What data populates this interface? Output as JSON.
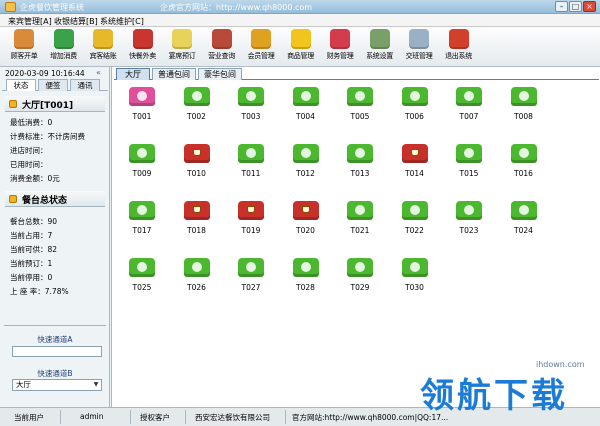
{
  "window": {
    "title": "企虎餐饮管理系统",
    "site": "企虎官方网站：http://www.qh8000.com",
    "buttons": [
      "–",
      "□",
      "×"
    ]
  },
  "menu": [
    {
      "label": "来宾管理[A]"
    },
    {
      "label": "收银结算[B]"
    },
    {
      "label": "系统维护[C]"
    }
  ],
  "toolbar": [
    {
      "label": "顾客开单",
      "icon": "customer-icon",
      "color": "#d98b3a"
    },
    {
      "label": "增加消费",
      "icon": "add-consume-icon",
      "color": "#3ca24a"
    },
    {
      "label": "宾客结账",
      "icon": "checkout-icon",
      "color": "#e6b82a"
    },
    {
      "label": "快餐外卖",
      "icon": "takeout-icon",
      "color": "#c9362f"
    },
    {
      "label": "宴席预订",
      "icon": "clock-icon",
      "color": "#e8d25a"
    },
    {
      "label": "营业查询",
      "icon": "report-icon",
      "color": "#b84a3a"
    },
    {
      "label": "会员管理",
      "icon": "members-icon",
      "color": "#e0a020"
    },
    {
      "label": "商品管理",
      "icon": "star-icon",
      "color": "#f2c51c"
    },
    {
      "label": "财务管理",
      "icon": "finance-icon",
      "color": "#d43c4c"
    },
    {
      "label": "系统设置",
      "icon": "settings-icon",
      "color": "#7aa06a"
    },
    {
      "label": "交班管理",
      "icon": "handshake-icon",
      "color": "#9ab0c4"
    },
    {
      "label": "退出系统",
      "icon": "exit-icon",
      "color": "#d2402c"
    }
  ],
  "sidebar": {
    "datetime": "2020-03-09 10:16:44",
    "collapse": "«",
    "tabs": [
      "状态",
      "便签",
      "通讯"
    ],
    "current_table": "大厅[T001]",
    "table_info": [
      "最低消费：0",
      "计费标准：不计房间费",
      "进店时间：",
      "已用时间：",
      "消费金额：0元"
    ],
    "status_title": "餐台总状态",
    "status_info": [
      "餐台总数：90",
      "当前占用：7",
      "当前可供：82",
      "当前预订：1",
      "当前停用：0",
      "上 座 率：7.78%"
    ],
    "quick_a_label": "快速通道A",
    "quick_a_value": "",
    "quick_b_label": "快速通道B",
    "quick_b_value": "大厅"
  },
  "area_tabs": [
    "大厅",
    "普通包间",
    "豪华包间"
  ],
  "tables": [
    {
      "id": "T001",
      "status": "selected"
    },
    {
      "id": "T002",
      "status": "free"
    },
    {
      "id": "T003",
      "status": "free"
    },
    {
      "id": "T004",
      "status": "free"
    },
    {
      "id": "T005",
      "status": "free"
    },
    {
      "id": "T006",
      "status": "free"
    },
    {
      "id": "T007",
      "status": "free"
    },
    {
      "id": "T008",
      "status": "free"
    },
    {
      "id": "T009",
      "status": "free"
    },
    {
      "id": "T010",
      "status": "occupied"
    },
    {
      "id": "T011",
      "status": "free"
    },
    {
      "id": "T012",
      "status": "free"
    },
    {
      "id": "T013",
      "status": "free"
    },
    {
      "id": "T014",
      "status": "occupied"
    },
    {
      "id": "T015",
      "status": "free"
    },
    {
      "id": "T016",
      "status": "free"
    },
    {
      "id": "T017",
      "status": "free"
    },
    {
      "id": "T018",
      "status": "occupied"
    },
    {
      "id": "T019",
      "status": "occupied"
    },
    {
      "id": "T020",
      "status": "occupied"
    },
    {
      "id": "T021",
      "status": "free"
    },
    {
      "id": "T022",
      "status": "free"
    },
    {
      "id": "T023",
      "status": "free"
    },
    {
      "id": "T024",
      "status": "free"
    },
    {
      "id": "T025",
      "status": "free"
    },
    {
      "id": "T026",
      "status": "free"
    },
    {
      "id": "T027",
      "status": "free"
    },
    {
      "id": "T028",
      "status": "free"
    },
    {
      "id": "T029",
      "status": "free"
    },
    {
      "id": "T030",
      "status": "free"
    }
  ],
  "colors": {
    "free": "#4cb82f",
    "occupied": "#c8302a",
    "selected": "#e0509a"
  },
  "statusbar": {
    "user_label": "当前用户",
    "user": "admin",
    "licensee_label": "授权客户",
    "licensee": "西安宏达餐饮有限公司",
    "website": "官方网站:http://www.qh8000.com|QQ:17..."
  },
  "watermark": {
    "text": "领航下载",
    "url": "ihdown.com"
  }
}
